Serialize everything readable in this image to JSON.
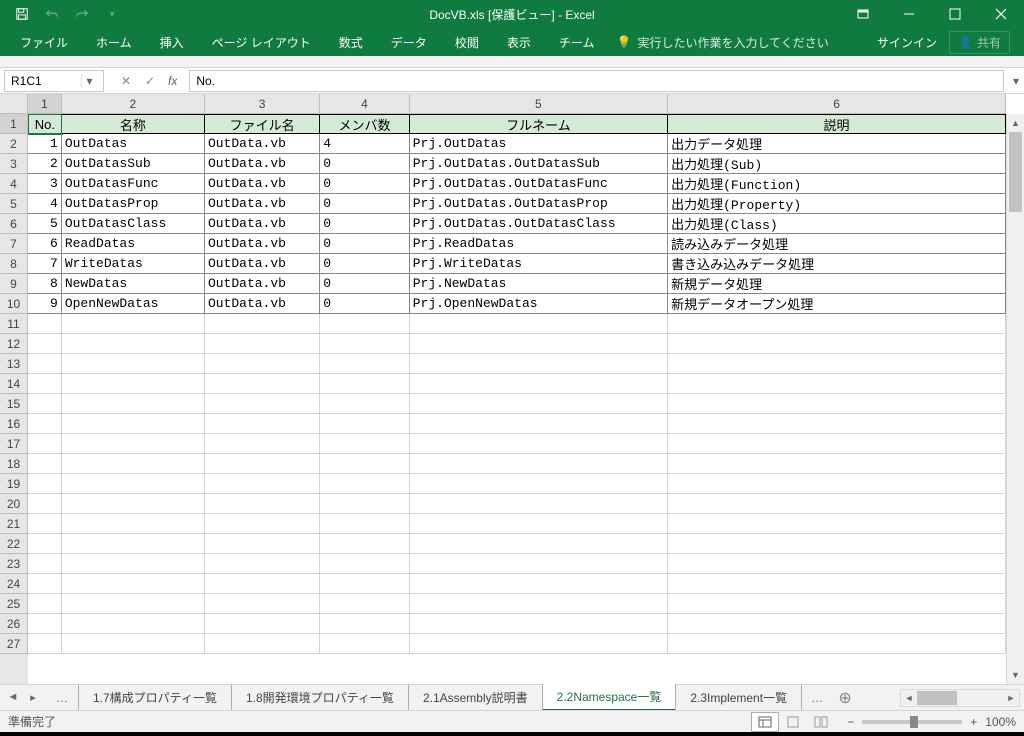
{
  "window": {
    "title": "DocVB.xls  [保護ビュー] - Excel",
    "signin": "サインイン",
    "share": "共有"
  },
  "ribbon": {
    "tabs": [
      "ファイル",
      "ホーム",
      "挿入",
      "ページ レイアウト",
      "数式",
      "データ",
      "校閲",
      "表示",
      "チーム"
    ],
    "tell_me": "実行したい作業を入力してください"
  },
  "formula": {
    "name_box": "R1C1",
    "value": "No."
  },
  "columns": {
    "widths": [
      "c1",
      "c2",
      "c3",
      "c4",
      "c5",
      "c6"
    ],
    "labels": [
      "1",
      "2",
      "3",
      "4",
      "5",
      "6"
    ]
  },
  "headers": [
    "No.",
    "名称",
    "ファイル名",
    "メンバ数",
    "フルネーム",
    "説明"
  ],
  "rows": [
    {
      "no": "1",
      "name": "OutDatas",
      "file": "OutData.vb",
      "members": "4",
      "full": "Prj.OutDatas",
      "desc": "出力データ処理"
    },
    {
      "no": "2",
      "name": "OutDatasSub",
      "file": "OutData.vb",
      "members": "0",
      "full": "Prj.OutDatas.OutDatasSub",
      "desc": "出力処理(Sub)"
    },
    {
      "no": "3",
      "name": "OutDatasFunc",
      "file": "OutData.vb",
      "members": "0",
      "full": "Prj.OutDatas.OutDatasFunc",
      "desc": "出力処理(Function)"
    },
    {
      "no": "4",
      "name": "OutDatasProp",
      "file": "OutData.vb",
      "members": "0",
      "full": "Prj.OutDatas.OutDatasProp",
      "desc": "出力処理(Property)"
    },
    {
      "no": "5",
      "name": "OutDatasClass",
      "file": "OutData.vb",
      "members": "0",
      "full": "Prj.OutDatas.OutDatasClass",
      "desc": "出力処理(Class)"
    },
    {
      "no": "6",
      "name": "ReadDatas",
      "file": "OutData.vb",
      "members": "0",
      "full": "Prj.ReadDatas",
      "desc": "読み込みデータ処理"
    },
    {
      "no": "7",
      "name": "WriteDatas",
      "file": "OutData.vb",
      "members": "0",
      "full": "Prj.WriteDatas",
      "desc": "書き込み込みデータ処理"
    },
    {
      "no": "8",
      "name": "NewDatas",
      "file": "OutData.vb",
      "members": "0",
      "full": "Prj.NewDatas",
      "desc": "新規データ処理"
    },
    {
      "no": "9",
      "name": "OpenNewDatas",
      "file": "OutData.vb",
      "members": "0",
      "full": "Prj.OpenNewDatas",
      "desc": "新規データオープン処理"
    }
  ],
  "row_labels": [
    "1",
    "2",
    "3",
    "4",
    "5",
    "6",
    "7",
    "8",
    "9",
    "10",
    "11",
    "12",
    "13",
    "14",
    "15",
    "16",
    "17",
    "18",
    "19",
    "20",
    "21",
    "22",
    "23",
    "24",
    "25",
    "26",
    "27"
  ],
  "sheets": {
    "tabs": [
      "1.7構成プロパティ一覧",
      "1.8開発環境プロパティ一覧",
      "2.1Assembly説明書",
      "2.2Namespace一覧",
      "2.3Implement一覧"
    ],
    "active_index": 3
  },
  "status": {
    "ready": "準備完了",
    "zoom": "100%"
  }
}
